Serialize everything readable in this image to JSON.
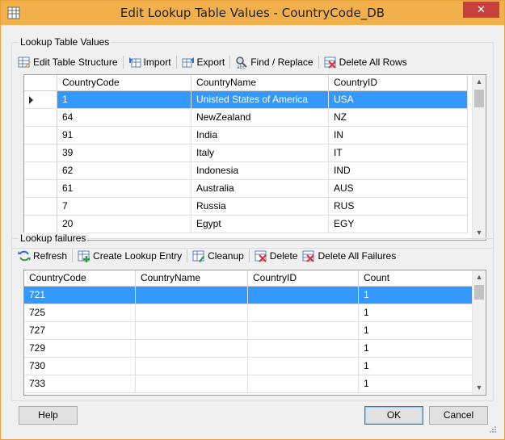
{
  "window": {
    "title": "Edit Lookup Table Values - CountryCode_DB",
    "close_label": "✕"
  },
  "lookup_group": {
    "label": "Lookup Table Values",
    "toolbar": {
      "edit_structure": "Edit Table Structure",
      "import": "Import",
      "export": "Export",
      "find_replace": "Find / Replace",
      "delete_all_rows": "Delete All Rows"
    },
    "columns": [
      "CountryCode",
      "CountryName",
      "CountryID"
    ],
    "rows": [
      [
        "1",
        "Unisted States of America",
        "USA"
      ],
      [
        "64",
        "NewZealand",
        "NZ"
      ],
      [
        "91",
        "India",
        "IN"
      ],
      [
        "39",
        "Italy",
        "IT"
      ],
      [
        "62",
        "Indonesia",
        "IND"
      ],
      [
        "61",
        "Australia",
        "AUS"
      ],
      [
        "7",
        "Russia",
        "RUS"
      ],
      [
        "20",
        "Egypt",
        "EGY"
      ]
    ],
    "selected_row": 0
  },
  "failures_group": {
    "label": "Lookup failures",
    "toolbar": {
      "refresh": "Refresh",
      "create_entry": "Create Lookup Entry",
      "cleanup": "Cleanup",
      "delete": "Delete",
      "delete_all": "Delete All Failures"
    },
    "columns": [
      "CountryCode",
      "CountryName",
      "CountryID",
      "Count"
    ],
    "rows": [
      [
        "721",
        "",
        "",
        "1"
      ],
      [
        "725",
        "",
        "",
        "1"
      ],
      [
        "727",
        "",
        "",
        "1"
      ],
      [
        "729",
        "",
        "",
        "1"
      ],
      [
        "730",
        "",
        "",
        "1"
      ],
      [
        "733",
        "",
        "",
        "1"
      ]
    ],
    "selected_row": 0
  },
  "buttons": {
    "help": "Help",
    "ok": "OK",
    "cancel": "Cancel"
  }
}
